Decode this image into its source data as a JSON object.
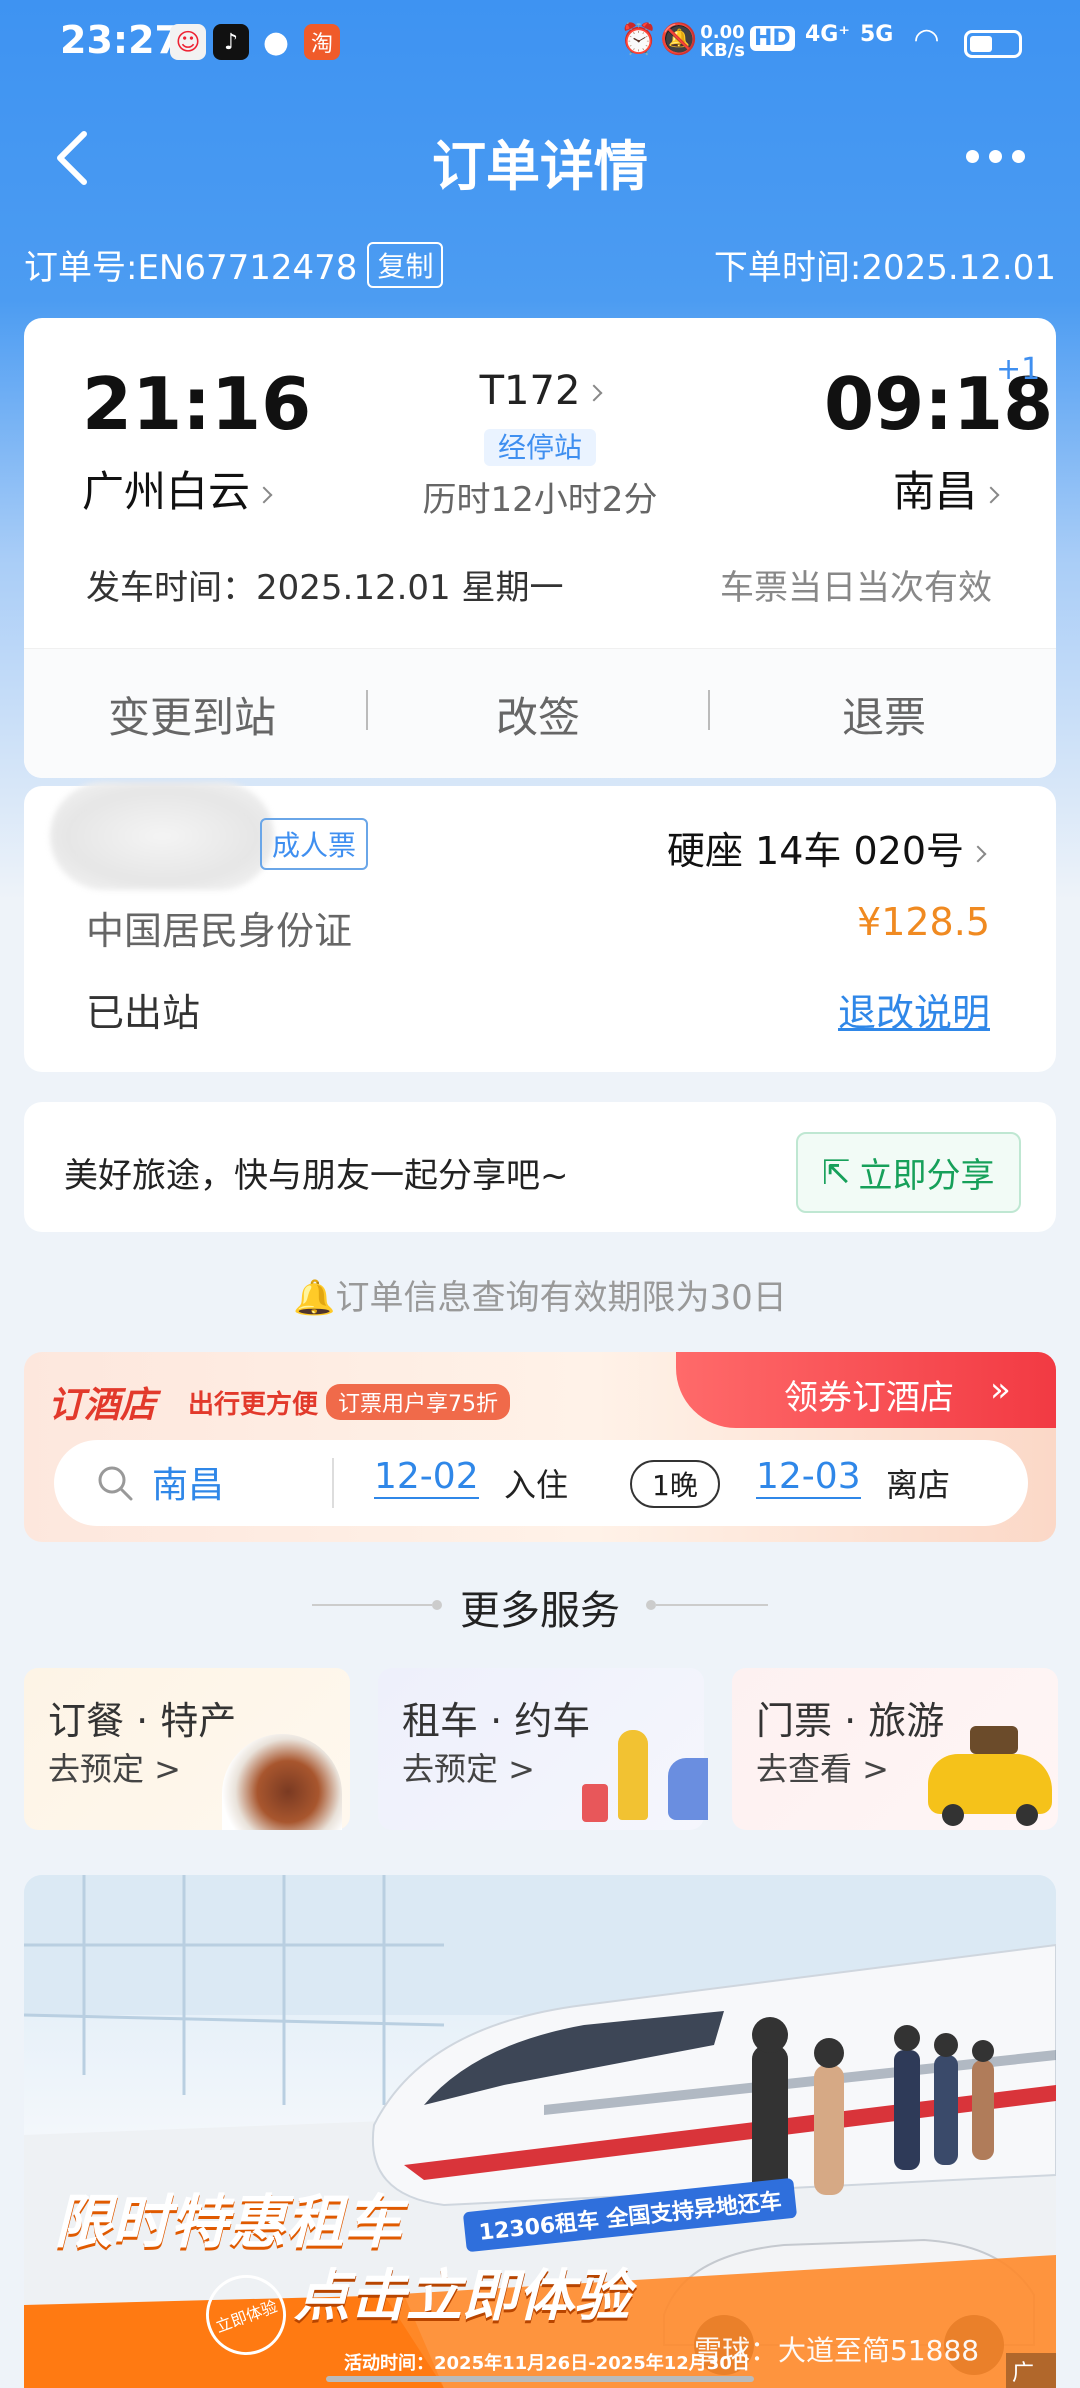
{
  "status_bar": {
    "time": "23:27",
    "net_speed": "0.00",
    "net_unit": "KB/s",
    "hd": "HD",
    "sig1": "4G⁺",
    "sig2": "5G"
  },
  "header": {
    "title": "订单详情"
  },
  "order": {
    "number": "订单号:EN67712478",
    "copy_label": "复制",
    "order_time": "下单时间:2025.12.01"
  },
  "trip": {
    "depart_time": "21:16",
    "depart_station": "广州白云",
    "train_no": "T172",
    "stop_tag": "经停站",
    "duration": "历时12小时2分",
    "arrive_time": "09:18",
    "arrive_plus": "+1",
    "arrive_station": "南昌",
    "depart_date": "发车时间：2025.12.01 星期一",
    "validity": "车票当日当次有效"
  },
  "actions": [
    "变更到站",
    "改签",
    "退票"
  ],
  "ticket": {
    "type_tag": "成人票",
    "seat": "硬座 14车 020号",
    "id_type": "中国居民身份证",
    "price": "¥128.5",
    "status": "已出站",
    "refund_link": "退改说明"
  },
  "share": {
    "text": "美好旅途，快与朋友一起分享吧~",
    "button": "立即分享"
  },
  "notice": "订单信息查询有效期限为30日",
  "hotel": {
    "brand": "订酒店",
    "slogan": "出行更方便",
    "promo": "订票用户享75折",
    "coupon": "领券订酒店",
    "city": "南昌",
    "checkin_date": "12-02",
    "checkin_label": "入住",
    "nights": "1晚",
    "checkout_date": "12-03",
    "checkout_label": "离店"
  },
  "more_services": {
    "title": "更多服务",
    "items": [
      {
        "title": "订餐 · 特产",
        "sub": "去预定 >"
      },
      {
        "title": "租车 · 约车",
        "sub": "去预定 >"
      },
      {
        "title": "门票 · 旅游",
        "sub": "去查看 >"
      }
    ]
  },
  "banner": {
    "headline1": "限时特惠租车",
    "headline2": "点击立即体验",
    "tag": "12306租车 全国支持异地还车",
    "activity": "活动时间：2025年11月26日-2025年12月30日",
    "ad": "广告",
    "watermark": "雪球：大道至简51888",
    "hand_label": "立即体验"
  },
  "colors": {
    "brand_blue": "#3e93f2",
    "price_orange": "#f08a21",
    "link_blue": "#2f87e8",
    "share_green": "#17a05a",
    "banner_orange": "#ff7a12"
  }
}
